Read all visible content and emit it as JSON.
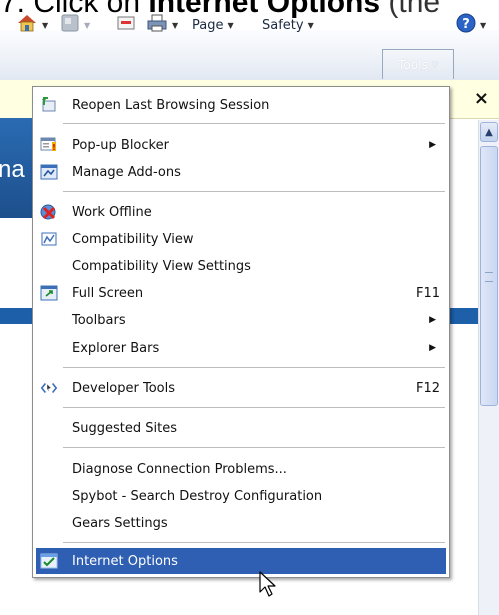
{
  "instruction": {
    "prefix": "7. Click on ",
    "bold": "Internet Options",
    "suffix": " (the"
  },
  "toolbar": {
    "page": "Page",
    "safety": "Safety",
    "tools": "Tools",
    "home_icon": "home-icon",
    "feeds_icon": "feeds-icon",
    "mail_icon": "mail-icon",
    "print_icon": "print-icon",
    "help_icon": "help-icon"
  },
  "page_fragment": "na",
  "infobar": {
    "close": "×"
  },
  "menu": {
    "items": [
      {
        "label": "Reopen Last Browsing Session",
        "icon": "reopen-session-icon"
      },
      {
        "label": "Pop-up Blocker",
        "icon": "popup-blocker-icon",
        "submenu": true
      },
      {
        "label": "Manage Add-ons",
        "icon": "addons-icon"
      },
      {
        "label": "Work Offline",
        "icon": "work-offline-icon"
      },
      {
        "label": "Compatibility View",
        "icon": "compatibility-view-icon"
      },
      {
        "label": "Compatibility View Settings"
      },
      {
        "label": "Full Screen",
        "icon": "full-screen-icon",
        "shortcut": "F11"
      },
      {
        "label": "Toolbars",
        "submenu": true
      },
      {
        "label": "Explorer Bars",
        "submenu": true
      },
      {
        "label": "Developer Tools",
        "icon": "developer-tools-icon",
        "shortcut": "F12"
      },
      {
        "label": "Suggested Sites"
      },
      {
        "label": "Diagnose Connection Problems..."
      },
      {
        "label": "Spybot - Search  Destroy Configuration"
      },
      {
        "label": "Gears Settings"
      },
      {
        "label": "Internet Options",
        "icon": "internet-options-icon",
        "highlighted": true
      }
    ],
    "highlight_color": "#2f5fb3"
  }
}
